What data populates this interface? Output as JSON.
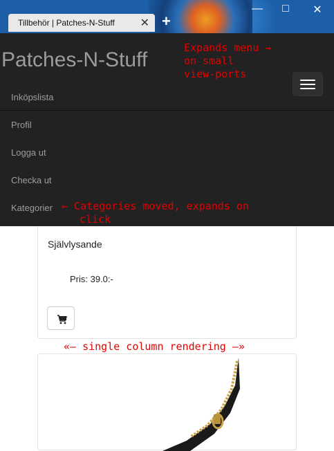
{
  "browser": {
    "tab_title": "Tillbehör | Patches-N-Stuff",
    "tab_close": "✕",
    "new_tab": "+",
    "minimize": "—",
    "maximize": "□",
    "close": "✕"
  },
  "navbar": {
    "brand": "Patches-N-Stuff",
    "items": [
      {
        "label": "Inköpslista"
      },
      {
        "label": "Profil"
      },
      {
        "label": "Logga ut"
      },
      {
        "label": "Checka ut"
      },
      {
        "label": "Kategorier"
      }
    ]
  },
  "annotations": {
    "menu_note_1": "Expands menu →",
    "menu_note_2": "on small",
    "menu_note_3": "view-ports",
    "categories_note_1": "← Categories moved, expands on",
    "categories_note_2": "click",
    "column_note": "«— single column rendering —»"
  },
  "products": [
    {
      "name": "Självlysande",
      "price": "Pris: 39.0:-"
    }
  ],
  "colors": {
    "navbar_bg": "#222222",
    "navbar_text": "#9d9d9d",
    "annotation": "#e60000"
  },
  "icons": [
    "cart-icon",
    "hamburger-icon",
    "close-icon",
    "plus-icon"
  ]
}
